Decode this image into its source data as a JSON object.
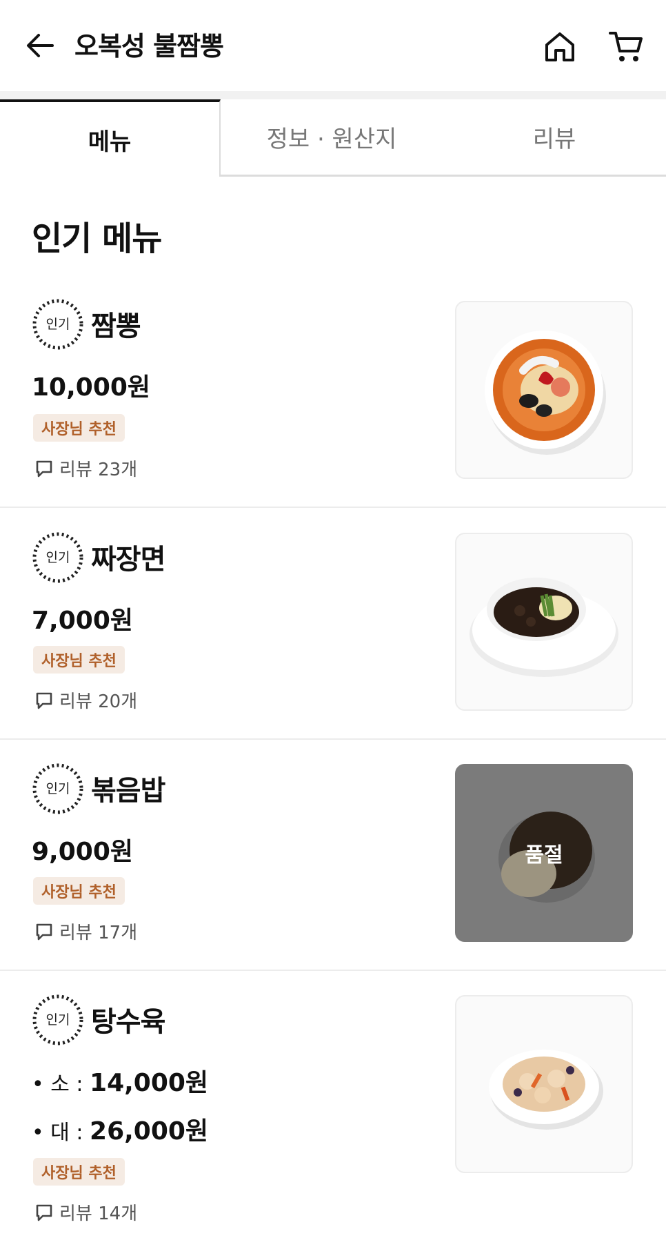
{
  "header": {
    "title": "오복성 불짬뽕",
    "back_icon": "arrow-left-icon",
    "home_icon": "home-icon",
    "cart_icon": "cart-icon"
  },
  "tabs": [
    {
      "label": "메뉴",
      "active": true
    },
    {
      "label": "정보 · 원산지",
      "active": false
    },
    {
      "label": "리뷰",
      "active": false
    }
  ],
  "section": {
    "title": "인기 메뉴"
  },
  "menu_items": [
    {
      "badge": "인기",
      "name": "짬뽕",
      "price": "10,000원",
      "tag": "사장님 추천",
      "reviews": "리뷰 23개",
      "image_icon": "jjamppong-bowl-image",
      "sold_out": false
    },
    {
      "badge": "인기",
      "name": "짜장면",
      "price": "7,000원",
      "tag": "사장님 추천",
      "reviews": "리뷰 20개",
      "image_icon": "jajangmyeon-bowl-image",
      "sold_out": false
    },
    {
      "badge": "인기",
      "name": "볶음밥",
      "price": "9,000원",
      "tag": "사장님 추천",
      "reviews": "리뷰 17개",
      "image_icon": "fried-rice-plate-image",
      "sold_out": true,
      "sold_out_label": "품절"
    },
    {
      "badge": "인기",
      "name": "탕수육",
      "prices": [
        {
          "bullet": "• 소 : ",
          "value": "14,000원"
        },
        {
          "bullet": "• 대 : ",
          "value": "26,000원"
        }
      ],
      "tag": "사장님 추천",
      "reviews": "리뷰 14개",
      "image_icon": "tangsuyuk-plate-image",
      "sold_out": false
    }
  ],
  "colors": {
    "tag_bg": "#f5ebe3",
    "tag_text": "#b0602a",
    "soldout_overlay": "#7b7b7b"
  }
}
